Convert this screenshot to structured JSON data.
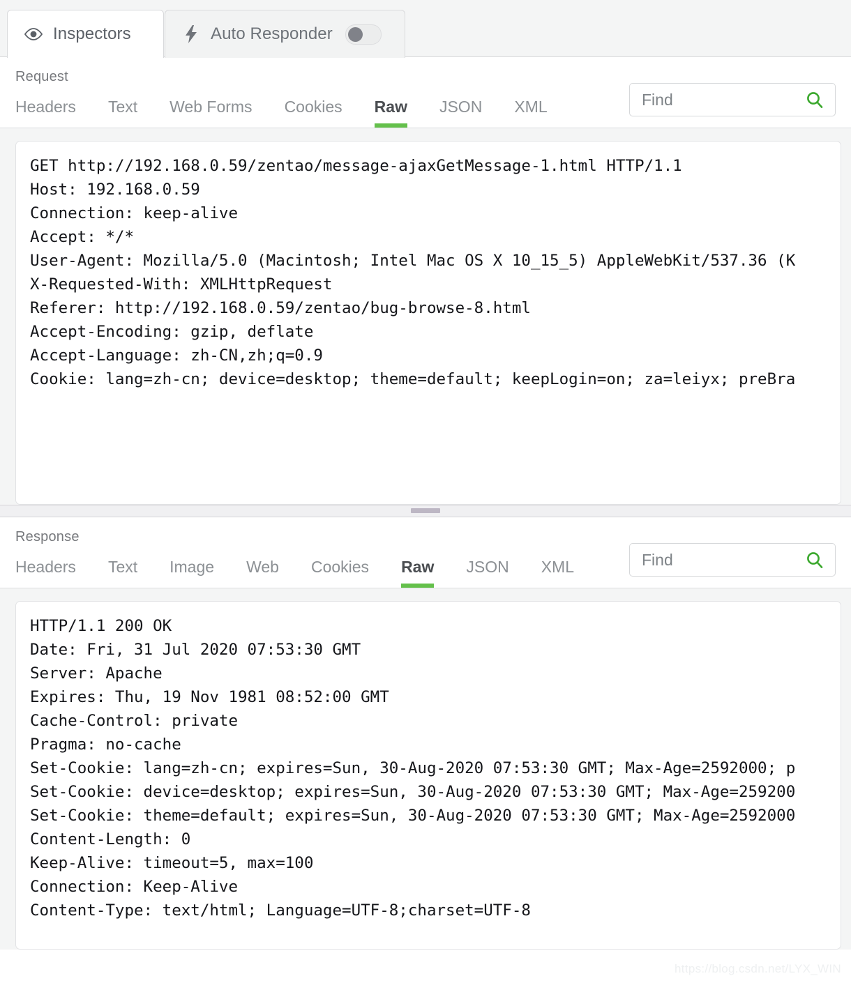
{
  "app": {
    "tabs": [
      {
        "label": "Inspectors",
        "icon": "eye-icon",
        "active": true
      },
      {
        "label": "Auto Responder",
        "icon": "bolt-icon",
        "active": false,
        "toggle_on": false
      }
    ]
  },
  "request": {
    "section_label": "Request",
    "tabs": [
      "Headers",
      "Text",
      "Web Forms",
      "Cookies",
      "Raw",
      "JSON",
      "XML"
    ],
    "selected_tab": "Raw",
    "find": {
      "placeholder": "Find",
      "value": "",
      "icon": "search-icon"
    },
    "raw": "GET http://192.168.0.59/zentao/message-ajaxGetMessage-1.html HTTP/1.1\nHost: 192.168.0.59\nConnection: keep-alive\nAccept: */*\nUser-Agent: Mozilla/5.0 (Macintosh; Intel Mac OS X 10_15_5) AppleWebKit/537.36 (K\nX-Requested-With: XMLHttpRequest\nReferer: http://192.168.0.59/zentao/bug-browse-8.html\nAccept-Encoding: gzip, deflate\nAccept-Language: zh-CN,zh;q=0.9\nCookie: lang=zh-cn; device=desktop; theme=default; keepLogin=on; za=leiyx; preBra"
  },
  "response": {
    "section_label": "Response",
    "tabs": [
      "Headers",
      "Text",
      "Image",
      "Web",
      "Cookies",
      "Raw",
      "JSON",
      "XML"
    ],
    "selected_tab": "Raw",
    "find": {
      "placeholder": "Find",
      "value": "",
      "icon": "search-icon"
    },
    "raw": "HTTP/1.1 200 OK\nDate: Fri, 31 Jul 2020 07:53:30 GMT\nServer: Apache\nExpires: Thu, 19 Nov 1981 08:52:00 GMT\nCache-Control: private\nPragma: no-cache\nSet-Cookie: lang=zh-cn; expires=Sun, 30-Aug-2020 07:53:30 GMT; Max-Age=2592000; p\nSet-Cookie: device=desktop; expires=Sun, 30-Aug-2020 07:53:30 GMT; Max-Age=259200\nSet-Cookie: theme=default; expires=Sun, 30-Aug-2020 07:53:30 GMT; Max-Age=2592000\nContent-Length: 0\nKeep-Alive: timeout=5, max=100\nConnection: Keep-Alive\nContent-Type: text/html; Language=UTF-8;charset=UTF-8"
  },
  "watermark": "https://blog.csdn.net/LYX_WIN",
  "colors": {
    "accent_green": "#64c04b",
    "search_green": "#3aa82c",
    "panel_bg": "#f4f5f5",
    "text_dark": "#15161a"
  }
}
